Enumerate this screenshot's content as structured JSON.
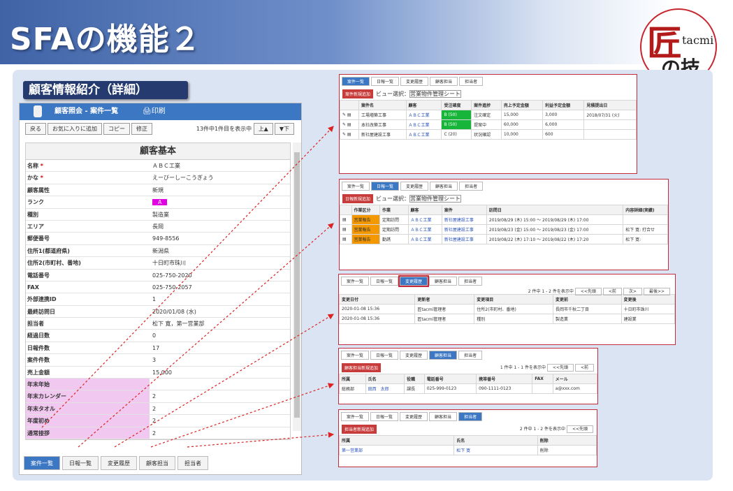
{
  "slide_title": "SFAの機能２",
  "logo": {
    "kanji": "匠",
    "tacmi": "tacmi",
    "bottom": "の技"
  },
  "section": "顧客情報紹介（詳細）",
  "app": {
    "header": "顧客照会 - 案件一覧",
    "print": "印刷",
    "toolbar": [
      "戻る",
      "お気に入りに追加",
      "コピー",
      "修正"
    ],
    "count": "13件中1件目を表示中",
    "up": "上▲",
    "down": "▼下",
    "detail_title": "顧客基本",
    "rows": [
      [
        "名称",
        "*",
        "ＡＢＣ工業"
      ],
      [
        "かな",
        "*",
        "えーびーしーこうぎょう"
      ],
      [
        "顧客属性",
        "",
        "新規"
      ],
      [
        "ランク",
        "",
        "A"
      ],
      [
        "種別",
        "",
        "製造業"
      ],
      [
        "エリア",
        "",
        "長岡"
      ],
      [
        "郵便番号",
        "",
        "949-8556"
      ],
      [
        "住所1(都道府県)",
        "",
        "新潟県"
      ],
      [
        "住所2(市町村、番地)",
        "",
        "十日町市珠川"
      ],
      [
        "電話番号",
        "",
        "025-750-2020"
      ],
      [
        "FAX",
        "",
        "025-750-2057"
      ],
      [
        "外部連携ID",
        "",
        "1"
      ],
      [
        "最終訪問日",
        "",
        "2020/01/08 (水)"
      ],
      [
        "担当者",
        "",
        "松下 寛，第一営業部"
      ],
      [
        "経過日数",
        "",
        "0"
      ],
      [
        "日報件数",
        "",
        "17"
      ],
      [
        "案件件数",
        "",
        "3"
      ],
      [
        "売上金額",
        "",
        "15,000"
      ],
      [
        "年末年始",
        "",
        ""
      ],
      [
        "年末カレンダー",
        "",
        "2"
      ],
      [
        "年末タオル",
        "",
        "2"
      ],
      [
        "年度初め",
        "",
        "2"
      ],
      [
        "通常接拶",
        "",
        "2"
      ]
    ],
    "tabs": [
      "案件一覧",
      "日報一覧",
      "変更履歴",
      "顧客担当",
      "担当者"
    ]
  },
  "s1": {
    "tabs": [
      "案件一覧",
      "日報一覧",
      "変更履歴",
      "顧客担当",
      "担当者"
    ],
    "btn": "案件新規追加",
    "view": "ビュー選択：",
    "select": "営業物件管理シート",
    "head": [
      "",
      "案件名",
      "顧客",
      "受注確度",
      "案件進捗",
      "売上予定金額",
      "利益予定金額",
      "見積提出日"
    ],
    "rows": [
      [
        "工場増築工事",
        "ＡＢＣ工業",
        "B (50)",
        "注文確定",
        "15,000",
        "3,000",
        "2018/07/31 (火)"
      ],
      [
        "本社改築工事",
        "ＡＢＣ工業",
        "B (50)",
        "提案中",
        "60,000",
        "6,000",
        ""
      ],
      [
        "新社屋建設工事",
        "ＡＢＣ工業",
        "C (20)",
        "状況確認",
        "10,000",
        "600",
        ""
      ]
    ]
  },
  "s2": {
    "tabs": [
      "案件一覧",
      "日報一覧",
      "変更履歴",
      "顧客担当",
      "担当者"
    ],
    "btn": "日報新規追加",
    "view": "ビュー選択：",
    "select": "営業物件管理シート",
    "head": [
      "",
      "作業区分",
      "作業",
      "顧客",
      "案件",
      "訪問日",
      "内容詳細(実績)"
    ],
    "rows": [
      [
        "営業報告",
        "定期訪問",
        "ＡＢＣ工業",
        "新社屋建設工事",
        "2019/08/29 (木) 15:00 ～ 2019/08/29 (木) 17:00",
        ""
      ],
      [
        "営業報告",
        "定期訪問",
        "ＡＢＣ工業",
        "新社屋建設工事",
        "2019/08/23 (金) 15:00 ～ 2019/08/23 (金) 17:00",
        "松下 寛:\n打合せ"
      ],
      [
        "営業報告",
        "勤誘",
        "ＡＢＣ工業",
        "新社屋建設工事",
        "2019/08/22 (木) 17:10 ～ 2019/08/22 (木) 17:20",
        "松下 寛:"
      ]
    ]
  },
  "s3": {
    "tabs": [
      "案件一覧",
      "日報一覧",
      "変更履歴",
      "顧客担当",
      "担当者"
    ],
    "count": "2 件中 1 - 2 件を表示中",
    "nav": [
      "<<先頭",
      "<前",
      "次>",
      "最後>>"
    ],
    "head": [
      "変更日付",
      "更新者",
      "変更項目",
      "変更前",
      "変更後"
    ],
    "rows": [
      [
        "2020-01-08 15:36",
        "匠tacmi管理者",
        "住所2(市町村、番地)",
        "長岡市千秋二丁目",
        "十日町市珠川"
      ],
      [
        "2020-01-08 15:36",
        "匠tacmi管理者",
        "種別",
        "製造業",
        "建設業"
      ]
    ]
  },
  "s4": {
    "tabs": [
      "案件一覧",
      "日報一覧",
      "変更履歴",
      "顧客担当",
      "担当者"
    ],
    "btn": "顧客担当新規追加",
    "count": "1 件中 1 - 1 件を表示中",
    "nav": [
      "<<先頭",
      "<前"
    ],
    "head": [
      "所属",
      "氏名",
      "役職",
      "電話番号",
      "携帯番号",
      "FAX",
      "メール"
    ],
    "row": [
      "総務部",
      "田西　太郎",
      "課長",
      "025-999-0123",
      "090-1111-0123",
      "",
      "a@xxx.com"
    ]
  },
  "s5": {
    "tabs": [
      "案件一覧",
      "日報一覧",
      "変更履歴",
      "顧客担当",
      "担当者"
    ],
    "btn": "担当者新規追加",
    "count": "2 件中 1 - 2 件を表示中",
    "nav": "<<先頭",
    "head": [
      "所属",
      "氏名",
      "削除"
    ],
    "row": [
      "第一営業部",
      "松下 寛",
      "削除"
    ]
  }
}
